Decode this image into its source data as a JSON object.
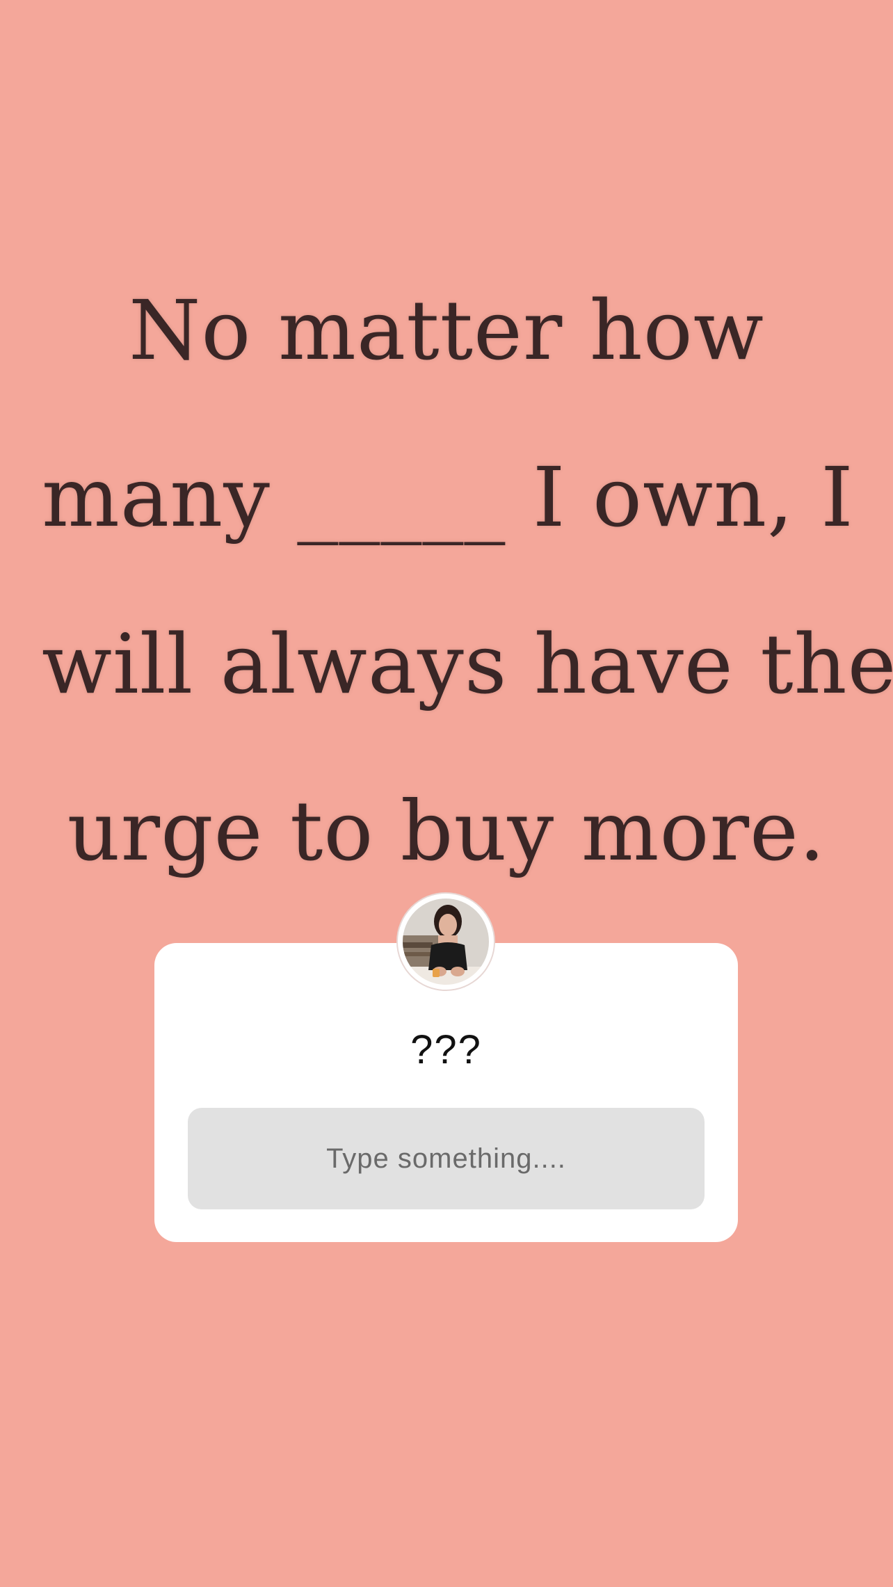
{
  "story": {
    "background_color": "#f4a79a",
    "quote_lines": [
      "No matter how",
      "many _____ I own, I",
      "will always have the",
      "urge to buy more."
    ]
  },
  "question_sticker": {
    "avatar_icon": "profile-photo",
    "question": "???",
    "answer_placeholder": "Type something...."
  }
}
